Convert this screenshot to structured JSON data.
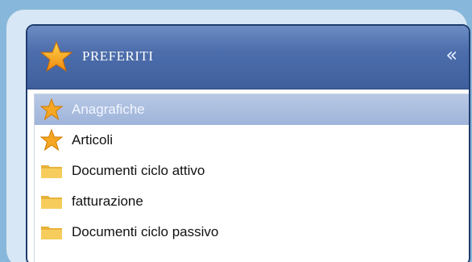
{
  "panel": {
    "title": "PREFERITI",
    "collapse_glyph": "«"
  },
  "items": [
    {
      "label": "Anagrafiche",
      "icon": "star-icon",
      "selected": true
    },
    {
      "label": "Articoli",
      "icon": "star-icon",
      "selected": false
    },
    {
      "label": "Documenti ciclo attivo",
      "icon": "folder-icon",
      "selected": false
    },
    {
      "label": "fatturazione",
      "icon": "folder-icon",
      "selected": false
    },
    {
      "label": "Documenti ciclo passivo",
      "icon": "folder-icon",
      "selected": false
    }
  ],
  "colors": {
    "header_bg": "#4d6eac",
    "selected_bg": "#a9bcdf",
    "star": "#f5a623",
    "folder": "#f0c24a",
    "background": "#87b7da"
  }
}
